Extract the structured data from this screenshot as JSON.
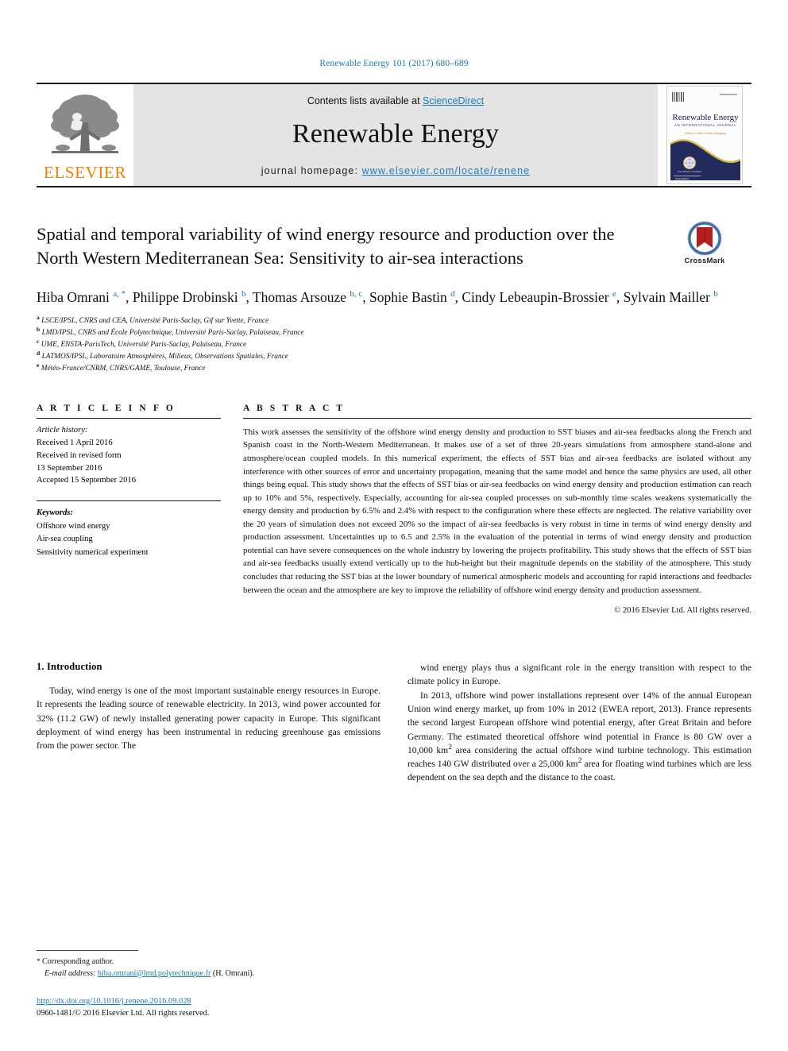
{
  "running_head": "Renewable Energy 101 (2017) 680–689",
  "masthead": {
    "publisher_name": "ELSEVIER",
    "publisher_logo_icon": "elsevier-tree-icon",
    "contents_prefix": "Contents lists available at ",
    "contents_link": "ScienceDirect",
    "journal_name": "Renewable Energy",
    "homepage_prefix": "journal homepage: ",
    "homepage_url": "www.elsevier.com/locate/renene",
    "cover": {
      "title": "Renewable Energy",
      "subtitle": "AN INTERNATIONAL JOURNAL",
      "editor_line": "Editor-in-Chief: Soteris Kalogirou",
      "barcode_icon": "barcode-icon",
      "emblem_icon": "globe-emblem-icon"
    }
  },
  "title": "Spatial and temporal variability of wind energy resource and production over the North Western Mediterranean Sea: Sensitivity to air-sea interactions",
  "crossmark": {
    "label": "CrossMark",
    "icon": "crossmark-badge-icon"
  },
  "authors_html": "Hiba Omrani <sup>a, *</sup>, Philippe Drobinski <sup>b</sup>, Thomas Arsouze <sup>b, c</sup>, Sophie Bastin <sup>d</sup>, Cindy Lebeaupin-Brossier <sup>e</sup>, Sylvain Mailler <sup>b</sup>",
  "affiliations": [
    {
      "marker": "a",
      "text": "LSCE/IPSL, CNRS and CEA, Université Paris-Saclay, Gif sur Yvette, France"
    },
    {
      "marker": "b",
      "text": "LMD/IPSL, CNRS and École Polytechnique, Université Paris-Saclay, Palaiseau, France"
    },
    {
      "marker": "c",
      "text": "UME, ENSTA-ParisTech, Université Paris-Saclay, Palaiseau, France"
    },
    {
      "marker": "d",
      "text": "LATMOS/IPSL, Laboratoire Atmosphères, Milieux, Observations Spatiales, France"
    },
    {
      "marker": "e",
      "text": "Météo-France/CNRM, CNRS/GAME, Toulouse, France"
    }
  ],
  "article_info": {
    "heading": "A R T I C L E   I N F O",
    "history_label": "Article history:",
    "history_lines": [
      "Received 1 April 2016",
      "Received in revised form",
      "13 September 2016",
      "Accepted 15 September 2016"
    ],
    "keywords_label": "Keywords:",
    "keywords": [
      "Offshore wind energy",
      "Air-sea coupling",
      "Sensitivity numerical experiment"
    ]
  },
  "abstract": {
    "heading": "A B S T R A C T",
    "text": "This work assesses the sensitivity of the offshore wind energy density and production to SST biases and air-sea feedbacks along the French and Spanish coast in the North-Western Mediterranean. It makes use of a set of three 20-years simulations from atmosphere stand-alone and atmosphere/ocean coupled models. In this numerical experiment, the effects of SST bias and air-sea feedbacks are isolated without any interference with other sources of error and uncertainty propagation, meaning that the same model and hence the same physics are used, all other things being equal. This study shows that the effects of SST bias or air-sea feedbacks on wind energy density and production estimation can reach up to 10% and 5%, respectively. Especially, accounting for air-sea coupled processes on sub-monthly time scales weakens systematically the energy density and production by 6.5% and 2.4% with respect to the configuration where these effects are neglected. The relative variability over the 20 years of simulation does not exceed 20% so the impact of air-sea feedbacks is very robust in time in terms of wind energy density and production assessment. Uncertainties up to 6.5 and 2.5% in the evaluation of the potential in terms of wind energy density and production potential can have severe consequences on the whole industry by lowering the projects profitability. This study shows that the effects of SST bias and air-sea feedbacks usually extend vertically up to the hub-height but their magnitude depends on the stability of the atmosphere. This study concludes that reducing the SST bias at the lower boundary of numerical atmospheric models and accounting for rapid interactions and feedbacks between the ocean and the atmosphere are key to improve the reliability of offshore wind energy density and production assessment.",
    "copyright": "© 2016 Elsevier Ltd. All rights reserved."
  },
  "body": {
    "section_number_title": "1. Introduction",
    "left_paragraph": "Today, wind energy is one of the most important sustainable energy resources in Europe. It represents the leading source of renewable electricity. In 2013, wind power accounted for 32% (11.2 GW) of newly installed generating power capacity in Europe. This significant deployment of wind energy has been instrumental in reducing greenhouse gas emissions from the power sector. The",
    "right_paragraph_1": "wind energy plays thus a significant role in the energy transition with respect to the climate policy in Europe.",
    "right_paragraph_2_html": "In 2013, offshore wind power installations represent over 14% of the annual European Union wind energy market, up from 10% in 2012 (EWEA report, 2013). France represents the second largest European offshore wind potential energy, after Great Britain and before Germany. The estimated theoretical offshore wind potential in France is 80 GW over a 10,000 km<sup>2</sup> area considering the actual offshore wind turbine technology. This estimation reaches 140 GW distributed over a 25,000 km<sup>2</sup> area for floating wind turbines which are less dependent on the sea depth and the distance to the coast."
  },
  "footnotes": {
    "corresponding_marker": "*",
    "corresponding_text": "Corresponding author.",
    "email_label": "E-mail address:",
    "email": "hiba.omrani@lmd.polytechnique.fr",
    "email_suffix": "(H. Omrani).",
    "doi": "http://dx.doi.org/10.1016/j.renene.2016.09.028",
    "issn_line": "0960-1481/© 2016 Elsevier Ltd. All rights reserved."
  },
  "colors": {
    "link_blue": "#1a7bb9",
    "elsevier_orange": "#f08000",
    "masthead_grey": "#e4e4e4",
    "cover_navy": "#232a5c",
    "cover_gold": "#d8b84a",
    "crossmark_blue": "#3a6ea5",
    "crossmark_red": "#b42020"
  }
}
